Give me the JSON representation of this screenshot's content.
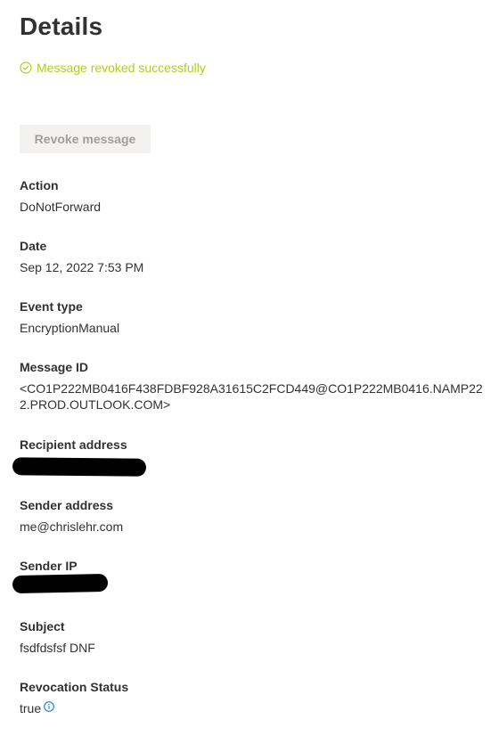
{
  "header": {
    "title": "Details"
  },
  "status": {
    "message": "Message revoked successfully",
    "icon": "check-circle-icon",
    "color": "#b3cc1e"
  },
  "actions": {
    "revoke_label": "Revoke message"
  },
  "fields": {
    "action": {
      "label": "Action",
      "value": "DoNotForward"
    },
    "date": {
      "label": "Date",
      "value": "Sep 12, 2022 7:53 PM"
    },
    "event_type": {
      "label": "Event type",
      "value": "EncryptionManual"
    },
    "message_id": {
      "label": "Message ID",
      "value": "<CO1P222MB0416F438FDBF928A31615C2FCD449@CO1P222MB0416.NAMP222.PROD.OUTLOOK.COM>"
    },
    "recipient_address": {
      "label": "Recipient address"
    },
    "sender_address": {
      "label": "Sender address",
      "value": "me@chrislehr.com"
    },
    "sender_ip": {
      "label": "Sender IP"
    },
    "subject": {
      "label": "Subject",
      "value": "fsdfdsfsf DNF"
    },
    "revocation_status": {
      "label": "Revocation Status",
      "value": "true",
      "icon": "info-icon"
    }
  }
}
